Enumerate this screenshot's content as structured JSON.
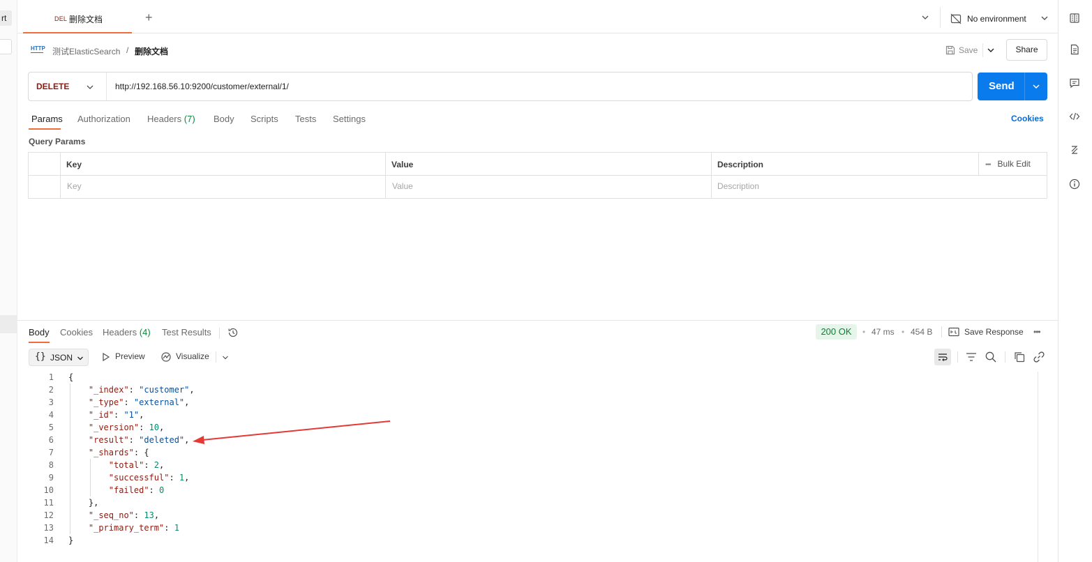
{
  "left_strip": {
    "fragment_text": "rt"
  },
  "top_tab": {
    "method": "DEL",
    "title": "删除文档",
    "new_tab": "+"
  },
  "environment": {
    "label": "No environment"
  },
  "breadcrumb": {
    "http_icon": "HTTP",
    "parent": "测试ElasticSearch",
    "separator": "/",
    "current": "删除文档"
  },
  "actions": {
    "save": "Save",
    "share": "Share"
  },
  "request": {
    "method": "DELETE",
    "url": "http://192.168.56.10:9200/customer/external/1/",
    "send": "Send",
    "method_color": "#8e1a10",
    "send_color": "#097bed"
  },
  "request_tabs": {
    "params": "Params",
    "authorization": "Authorization",
    "headers": "Headers",
    "headers_count": "(7)",
    "body": "Body",
    "scripts": "Scripts",
    "tests": "Tests",
    "settings": "Settings",
    "cookies": "Cookies"
  },
  "query_params": {
    "title": "Query Params",
    "headers": {
      "key": "Key",
      "value": "Value",
      "description": "Description",
      "bulk_edit": "Bulk Edit",
      "more": "•••"
    },
    "placeholders": {
      "key": "Key",
      "value": "Value",
      "description": "Description"
    }
  },
  "response_tabs": {
    "body": "Body",
    "cookies": "Cookies",
    "headers": "Headers",
    "headers_count": "(4)",
    "test_results": "Test Results"
  },
  "response_meta": {
    "status": "200 OK",
    "time": "47 ms",
    "size": "454 B",
    "dot": "•",
    "save_response": "Save Response",
    "more": "•••",
    "status_color": "#06812f"
  },
  "format": {
    "brace": "{}",
    "type": "JSON",
    "preview": "Preview",
    "visualize": "Visualize"
  },
  "code": {
    "line_numbers": [
      "1",
      "2",
      "3",
      "4",
      "5",
      "6",
      "7",
      "8",
      "9",
      "10",
      "11",
      "12",
      "13",
      "14"
    ],
    "lines": [
      {
        "indent": 0,
        "parts": [
          {
            "c": "p",
            "t": "{"
          }
        ]
      },
      {
        "indent": 1,
        "parts": [
          {
            "c": "k",
            "t": "\"_index\""
          },
          {
            "c": "p",
            "t": ": "
          },
          {
            "c": "s",
            "t": "\"customer\""
          },
          {
            "c": "p",
            "t": ","
          }
        ]
      },
      {
        "indent": 1,
        "parts": [
          {
            "c": "k",
            "t": "\"_type\""
          },
          {
            "c": "p",
            "t": ": "
          },
          {
            "c": "s",
            "t": "\"external\""
          },
          {
            "c": "p",
            "t": ","
          }
        ]
      },
      {
        "indent": 1,
        "parts": [
          {
            "c": "k",
            "t": "\"_id\""
          },
          {
            "c": "p",
            "t": ": "
          },
          {
            "c": "s",
            "t": "\"1\""
          },
          {
            "c": "p",
            "t": ","
          }
        ]
      },
      {
        "indent": 1,
        "parts": [
          {
            "c": "k",
            "t": "\"_version\""
          },
          {
            "c": "p",
            "t": ": "
          },
          {
            "c": "n",
            "t": "10"
          },
          {
            "c": "p",
            "t": ","
          }
        ]
      },
      {
        "indent": 1,
        "parts": [
          {
            "c": "k",
            "t": "\"result\""
          },
          {
            "c": "p",
            "t": ": "
          },
          {
            "c": "s",
            "t": "\"deleted\""
          },
          {
            "c": "p",
            "t": ","
          }
        ]
      },
      {
        "indent": 1,
        "parts": [
          {
            "c": "k",
            "t": "\"_shards\""
          },
          {
            "c": "p",
            "t": ": {"
          }
        ]
      },
      {
        "indent": 2,
        "parts": [
          {
            "c": "k",
            "t": "\"total\""
          },
          {
            "c": "p",
            "t": ": "
          },
          {
            "c": "n",
            "t": "2"
          },
          {
            "c": "p",
            "t": ","
          }
        ]
      },
      {
        "indent": 2,
        "parts": [
          {
            "c": "k",
            "t": "\"successful\""
          },
          {
            "c": "p",
            "t": ": "
          },
          {
            "c": "n",
            "t": "1"
          },
          {
            "c": "p",
            "t": ","
          }
        ]
      },
      {
        "indent": 2,
        "parts": [
          {
            "c": "k",
            "t": "\"failed\""
          },
          {
            "c": "p",
            "t": ": "
          },
          {
            "c": "n",
            "t": "0"
          }
        ]
      },
      {
        "indent": 1,
        "parts": [
          {
            "c": "p",
            "t": "},"
          }
        ]
      },
      {
        "indent": 1,
        "parts": [
          {
            "c": "k",
            "t": "\"_seq_no\""
          },
          {
            "c": "p",
            "t": ": "
          },
          {
            "c": "n",
            "t": "13"
          },
          {
            "c": "p",
            "t": ","
          }
        ]
      },
      {
        "indent": 1,
        "parts": [
          {
            "c": "k",
            "t": "\"_primary_term\""
          },
          {
            "c": "p",
            "t": ": "
          },
          {
            "c": "n",
            "t": "1"
          }
        ]
      },
      {
        "indent": 0,
        "parts": [
          {
            "c": "p",
            "t": "}"
          }
        ]
      }
    ]
  },
  "annotation": {
    "arrow_color": "#e53935"
  },
  "icons": {
    "chevron": "chevron-down-icon",
    "env": "no-environment-icon",
    "rail": [
      "document-icon",
      "comments-icon",
      "code-icon",
      "related-icon",
      "info-icon"
    ],
    "history": "history-icon",
    "save": "save-icon",
    "save_response": "save-response-icon",
    "preview": "play-icon",
    "visualize": "visualize-icon",
    "tools": [
      "wrap-icon",
      "filter-icon",
      "search-icon",
      "copy-icon",
      "link-icon"
    ]
  }
}
